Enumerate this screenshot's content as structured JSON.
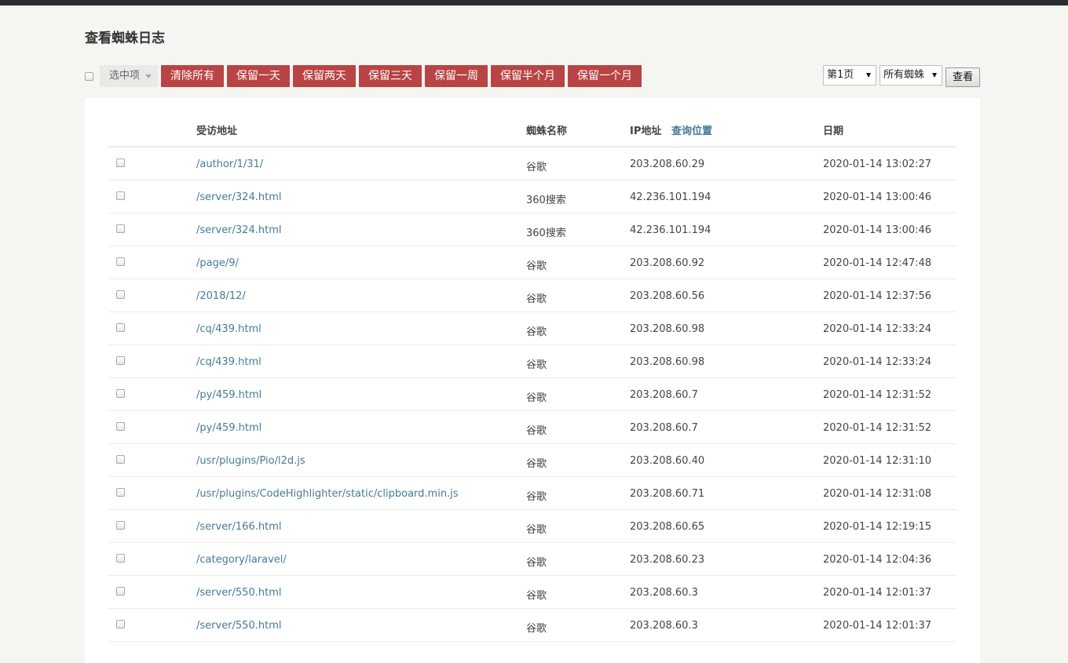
{
  "page": {
    "title": "查看蜘蛛日志"
  },
  "toolbar": {
    "select_label": "选中项",
    "buttons": [
      "清除所有",
      "保留一天",
      "保留两天",
      "保留三天",
      "保留一周",
      "保留半个月",
      "保留一个月"
    ],
    "page_select": "第1页",
    "spider_select": "所有蜘蛛",
    "view_label": "查看"
  },
  "table": {
    "headers": {
      "url": "受访地址",
      "spider": "蜘蛛名称",
      "ip": "IP地址",
      "locate": "查询位置",
      "date": "日期"
    },
    "rows": [
      {
        "url": "/author/1/31/",
        "spider": "谷歌",
        "ip": "203.208.60.29",
        "date": "2020-01-14 13:02:27"
      },
      {
        "url": "/server/324.html",
        "spider": "360搜索",
        "ip": "42.236.101.194",
        "date": "2020-01-14 13:00:46"
      },
      {
        "url": "/server/324.html",
        "spider": "360搜索",
        "ip": "42.236.101.194",
        "date": "2020-01-14 13:00:46"
      },
      {
        "url": "/page/9/",
        "spider": "谷歌",
        "ip": "203.208.60.92",
        "date": "2020-01-14 12:47:48"
      },
      {
        "url": "/2018/12/",
        "spider": "谷歌",
        "ip": "203.208.60.56",
        "date": "2020-01-14 12:37:56"
      },
      {
        "url": "/cq/439.html",
        "spider": "谷歌",
        "ip": "203.208.60.98",
        "date": "2020-01-14 12:33:24"
      },
      {
        "url": "/cq/439.html",
        "spider": "谷歌",
        "ip": "203.208.60.98",
        "date": "2020-01-14 12:33:24"
      },
      {
        "url": "/py/459.html",
        "spider": "谷歌",
        "ip": "203.208.60.7",
        "date": "2020-01-14 12:31:52"
      },
      {
        "url": "/py/459.html",
        "spider": "谷歌",
        "ip": "203.208.60.7",
        "date": "2020-01-14 12:31:52"
      },
      {
        "url": "/usr/plugins/Pio/l2d.js",
        "spider": "谷歌",
        "ip": "203.208.60.40",
        "date": "2020-01-14 12:31:10"
      },
      {
        "url": "/usr/plugins/CodeHighlighter/static/clipboard.min.js",
        "spider": "谷歌",
        "ip": "203.208.60.71",
        "date": "2020-01-14 12:31:08"
      },
      {
        "url": "/server/166.html",
        "spider": "谷歌",
        "ip": "203.208.60.65",
        "date": "2020-01-14 12:19:15"
      },
      {
        "url": "/category/laravel/",
        "spider": "谷歌",
        "ip": "203.208.60.23",
        "date": "2020-01-14 12:04:36"
      },
      {
        "url": "/server/550.html",
        "spider": "谷歌",
        "ip": "203.208.60.3",
        "date": "2020-01-14 12:01:37"
      },
      {
        "url": "/server/550.html",
        "spider": "谷歌",
        "ip": "203.208.60.3",
        "date": "2020-01-14 12:01:37"
      }
    ]
  }
}
